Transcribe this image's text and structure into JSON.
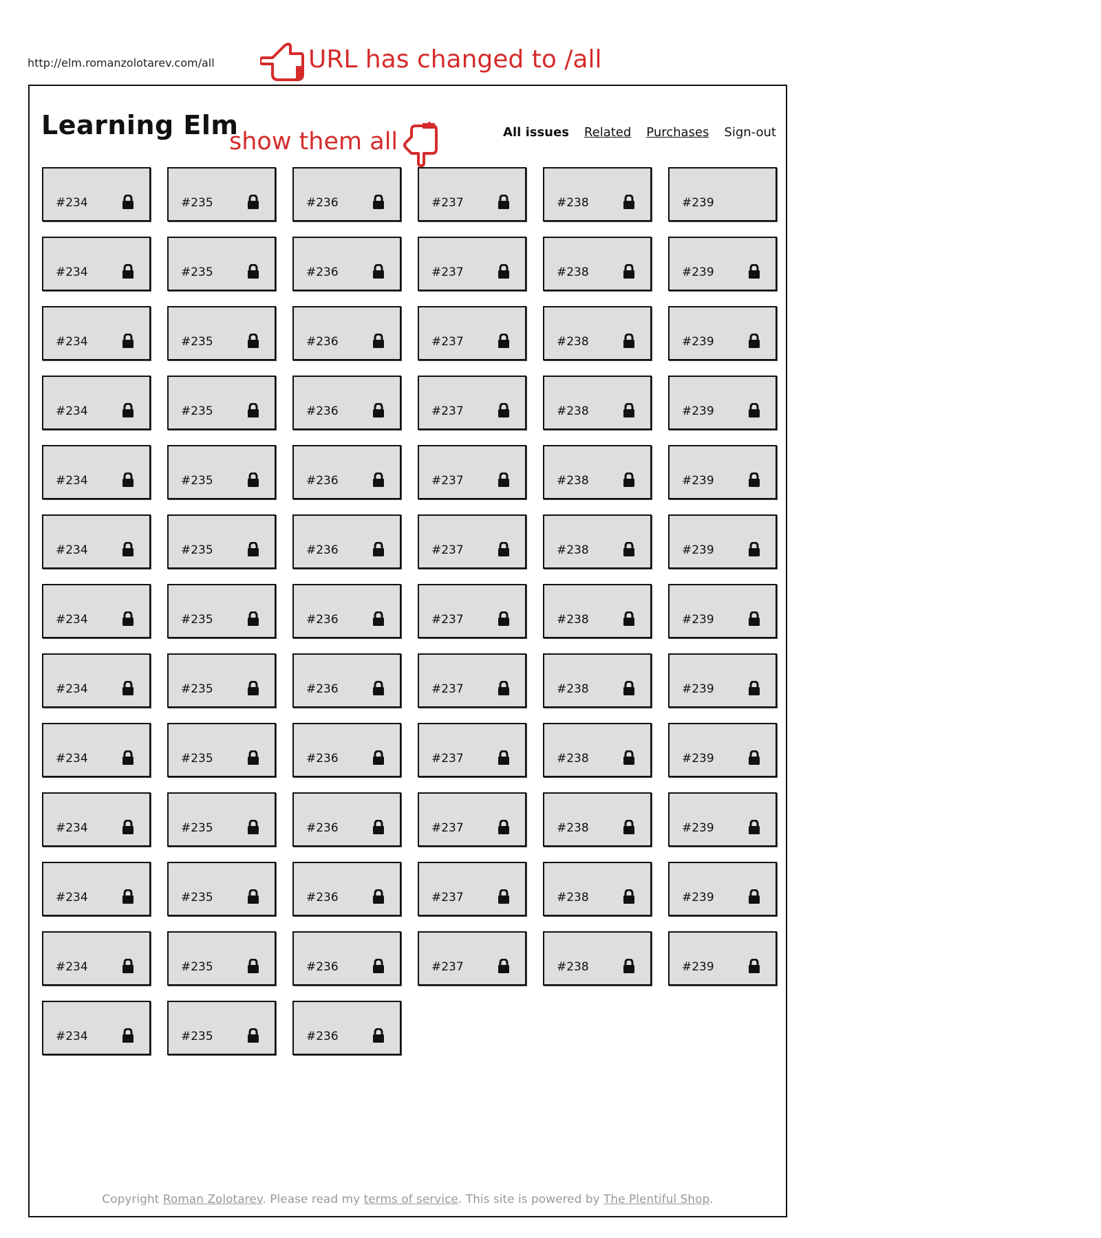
{
  "browser": {
    "url": "http://elm.romanzolotarev.com/all"
  },
  "annotations": {
    "top": "URL has changed to /all",
    "mid": "show them all"
  },
  "header": {
    "logo": "Learning Elm",
    "nav": [
      {
        "label": "All issues",
        "active": true
      },
      {
        "label": "Related",
        "active": false
      },
      {
        "label": "Purchases",
        "active": false
      },
      {
        "label": "Sign-out",
        "active": false
      }
    ]
  },
  "issues": {
    "rows": [
      [
        {
          "n": "#234",
          "locked": true
        },
        {
          "n": "#235",
          "locked": true
        },
        {
          "n": "#236",
          "locked": true
        },
        {
          "n": "#237",
          "locked": true
        },
        {
          "n": "#238",
          "locked": true
        },
        {
          "n": "#239",
          "locked": false
        }
      ],
      [
        {
          "n": "#234",
          "locked": true
        },
        {
          "n": "#235",
          "locked": true
        },
        {
          "n": "#236",
          "locked": true
        },
        {
          "n": "#237",
          "locked": true
        },
        {
          "n": "#238",
          "locked": true
        },
        {
          "n": "#239",
          "locked": true
        }
      ],
      [
        {
          "n": "#234",
          "locked": true
        },
        {
          "n": "#235",
          "locked": true
        },
        {
          "n": "#236",
          "locked": true
        },
        {
          "n": "#237",
          "locked": true
        },
        {
          "n": "#238",
          "locked": true
        },
        {
          "n": "#239",
          "locked": true
        }
      ],
      [
        {
          "n": "#234",
          "locked": true
        },
        {
          "n": "#235",
          "locked": true
        },
        {
          "n": "#236",
          "locked": true
        },
        {
          "n": "#237",
          "locked": true
        },
        {
          "n": "#238",
          "locked": true
        },
        {
          "n": "#239",
          "locked": true
        }
      ],
      [
        {
          "n": "#234",
          "locked": true
        },
        {
          "n": "#235",
          "locked": true
        },
        {
          "n": "#236",
          "locked": true
        },
        {
          "n": "#237",
          "locked": true
        },
        {
          "n": "#238",
          "locked": true
        },
        {
          "n": "#239",
          "locked": true
        }
      ],
      [
        {
          "n": "#234",
          "locked": true
        },
        {
          "n": "#235",
          "locked": true
        },
        {
          "n": "#236",
          "locked": true
        },
        {
          "n": "#237",
          "locked": true
        },
        {
          "n": "#238",
          "locked": true
        },
        {
          "n": "#239",
          "locked": true
        }
      ],
      [
        {
          "n": "#234",
          "locked": true
        },
        {
          "n": "#235",
          "locked": true
        },
        {
          "n": "#236",
          "locked": true
        },
        {
          "n": "#237",
          "locked": true
        },
        {
          "n": "#238",
          "locked": true
        },
        {
          "n": "#239",
          "locked": true
        }
      ],
      [
        {
          "n": "#234",
          "locked": true
        },
        {
          "n": "#235",
          "locked": true
        },
        {
          "n": "#236",
          "locked": true
        },
        {
          "n": "#237",
          "locked": true
        },
        {
          "n": "#238",
          "locked": true
        },
        {
          "n": "#239",
          "locked": true
        }
      ],
      [
        {
          "n": "#234",
          "locked": true
        },
        {
          "n": "#235",
          "locked": true
        },
        {
          "n": "#236",
          "locked": true
        },
        {
          "n": "#237",
          "locked": true
        },
        {
          "n": "#238",
          "locked": true
        },
        {
          "n": "#239",
          "locked": true
        }
      ],
      [
        {
          "n": "#234",
          "locked": true
        },
        {
          "n": "#235",
          "locked": true
        },
        {
          "n": "#236",
          "locked": true
        },
        {
          "n": "#237",
          "locked": true
        },
        {
          "n": "#238",
          "locked": true
        },
        {
          "n": "#239",
          "locked": true
        }
      ],
      [
        {
          "n": "#234",
          "locked": true
        },
        {
          "n": "#235",
          "locked": true
        },
        {
          "n": "#236",
          "locked": true
        },
        {
          "n": "#237",
          "locked": true
        },
        {
          "n": "#238",
          "locked": true
        },
        {
          "n": "#239",
          "locked": true
        }
      ],
      [
        {
          "n": "#234",
          "locked": true
        },
        {
          "n": "#235",
          "locked": true
        },
        {
          "n": "#236",
          "locked": true
        },
        {
          "n": "#237",
          "locked": true
        },
        {
          "n": "#238",
          "locked": true
        },
        {
          "n": "#239",
          "locked": true
        }
      ],
      [
        {
          "n": "#234",
          "locked": true
        },
        {
          "n": "#235",
          "locked": true
        },
        {
          "n": "#236",
          "locked": true
        }
      ]
    ]
  },
  "footer": {
    "t1": "Copyright ",
    "author": "Roman Zolotarev",
    "t2": ". Please read my ",
    "tos": "terms of service",
    "t3": ". This site is powered by ",
    "shop": "The Plentiful Shop",
    "t4": "."
  },
  "icons": {
    "lock": "lock-icon",
    "hand_pointing_left": "hand-pointing-left-icon",
    "hand_pointing_down": "hand-pointing-down-icon"
  },
  "colors": {
    "annotation": "#d62b2b",
    "tile_bg": "#dedede",
    "footer_text": "#999999"
  }
}
